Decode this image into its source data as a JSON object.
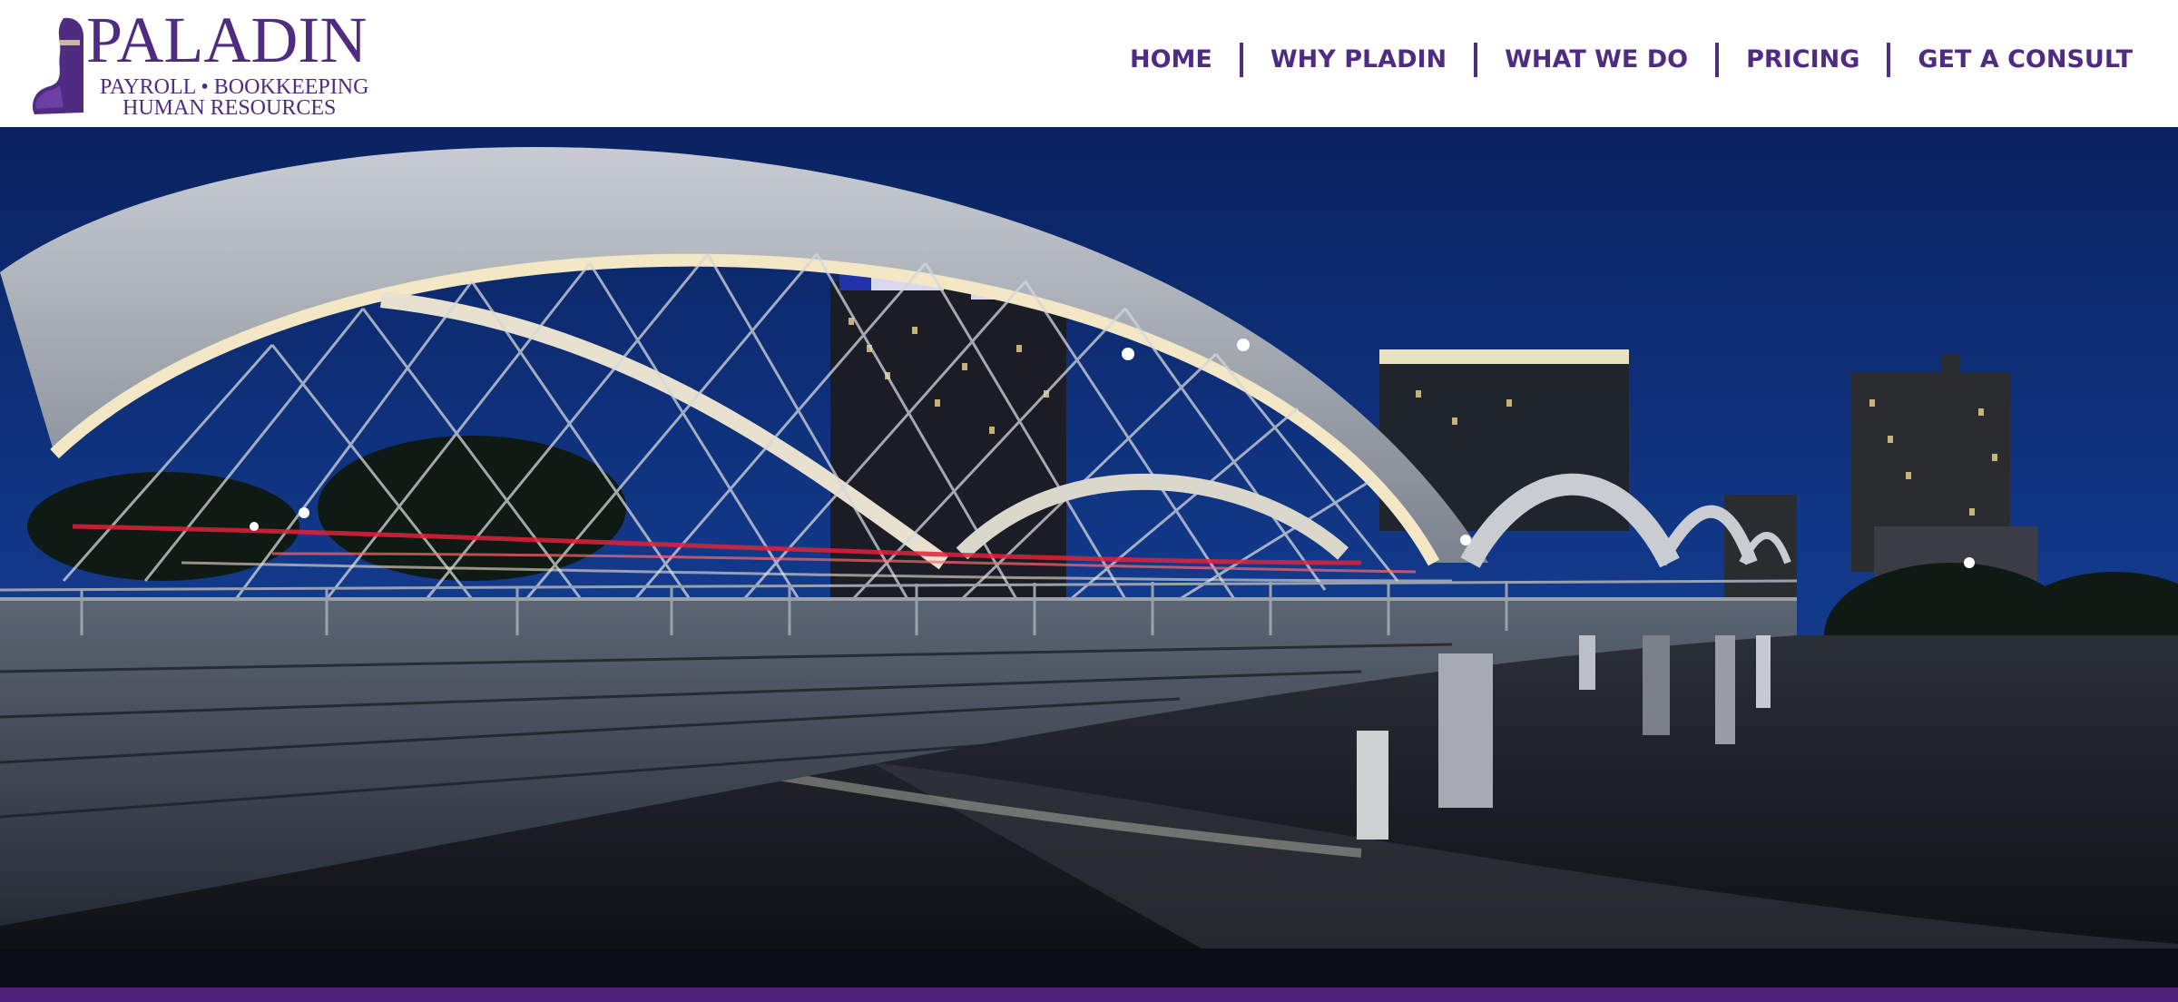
{
  "brand": {
    "name": "PALADIN",
    "tagline_line1": "PAYROLL • BOOKKEEPING",
    "tagline_line2": "HUMAN RESOURCES",
    "color": "#4f2b82"
  },
  "nav": {
    "items": [
      {
        "label": "HOME"
      },
      {
        "label": "WHY PLADIN"
      },
      {
        "label": "WHAT WE DO"
      },
      {
        "label": "PRICING"
      },
      {
        "label": "GET A CONSULT"
      }
    ]
  },
  "hero": {
    "image": "night photo of an arched pedestrian bridge with city skyline"
  },
  "colors": {
    "accent": "#4f2b82",
    "footer_bar": "#4f2077",
    "sky": "#0e2a66"
  },
  "icons": [
    "knight-logo-icon"
  ]
}
